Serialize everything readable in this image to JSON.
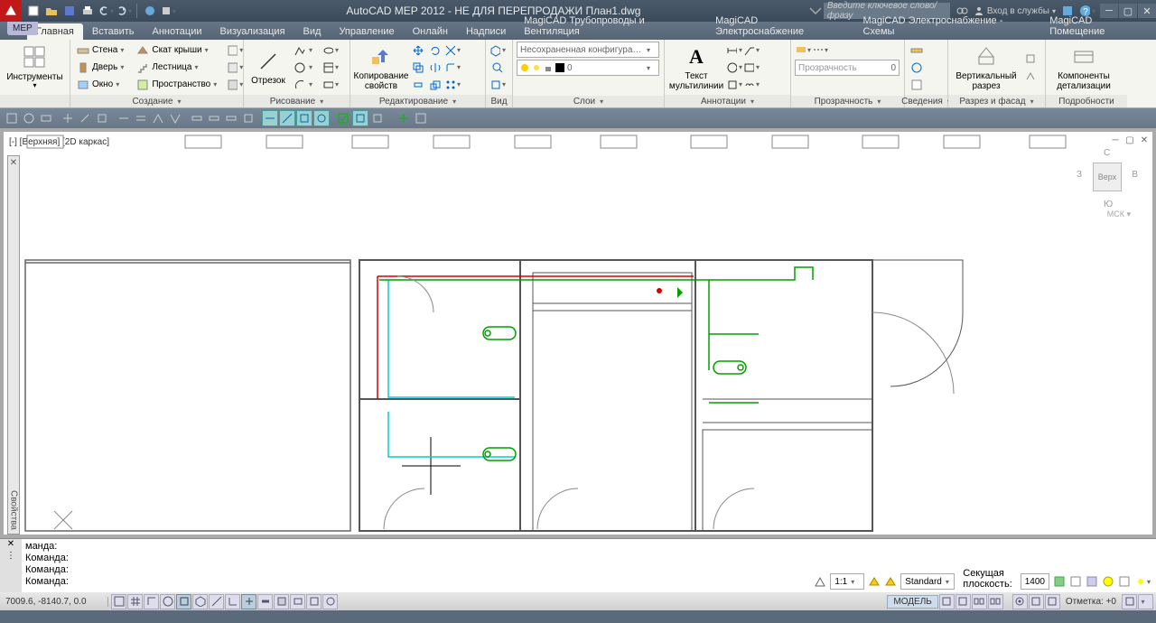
{
  "title": "AutoCAD MEP 2012 - НЕ ДЛЯ ПЕРЕПРОДАЖИ    План1.dwg",
  "search_placeholder": "Введите ключевое слово/фразу",
  "login": "Вход в службы",
  "mep_tab": "МЕР",
  "tabs": [
    "Главная",
    "Вставить",
    "Аннотации",
    "Визуализация",
    "Вид",
    "Управление",
    "Онлайн",
    "Надписи",
    "MagiCAD Трубопроводы и Вентиляция",
    "MagiCAD Электроснабжение",
    "MagiCAD Электроснабжение - Схемы",
    "MagiCAD Помещение"
  ],
  "panels": {
    "tools": {
      "title": "",
      "btn": "Инструменты"
    },
    "build": {
      "title": "Создание",
      "wall": "Стена",
      "roof": "Скат крыши",
      "door": "Дверь",
      "stair": "Лестница",
      "window": "Окно",
      "space": "Пространство"
    },
    "draw": {
      "title": "Рисование",
      "line": "Отрезок"
    },
    "edit": {
      "title": "Редактирование",
      "copyprops": "Копирование свойств"
    },
    "view": {
      "title": "Вид"
    },
    "layers": {
      "title": "Слои",
      "config": "Несохраненная конфигурация сл",
      "layer0": "0"
    },
    "annot": {
      "title": "Аннотации",
      "text": "Текст",
      "mtext": "мультилинии"
    },
    "transp": {
      "title": "Прозрачность",
      "label": "Прозрачность",
      "value": "0"
    },
    "info": {
      "title": "Сведения"
    },
    "section": {
      "title": "Разрез и фасад",
      "btn": "Вертикальный разрез"
    },
    "detail": {
      "title": "Подробности",
      "btn": "Компоненты детализации"
    }
  },
  "vp_label": "[-] [Верхняя] [2D каркас]",
  "palette_title": "Свойства",
  "viewcube": {
    "top": "Верх",
    "n": "С",
    "s": "Ю",
    "e": "В",
    "w": "З",
    "wcs": "МСК"
  },
  "cmd": {
    "lines": [
      "манда:",
      "Команда:",
      "Команда:",
      "Команда:"
    ]
  },
  "status_right": {
    "scale": "1:1",
    "standard": "Standard",
    "section_plane": "Секущая плоскость:",
    "section_value": "1400",
    "model": "МОДЕЛЬ",
    "mark": "Отметка: +0"
  },
  "coords": "7009.6, -8140.7, 0.0"
}
